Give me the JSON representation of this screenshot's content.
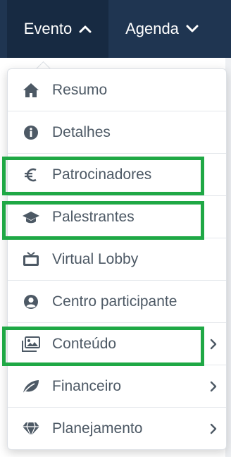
{
  "nav": {
    "evento": "Evento",
    "agenda": "Agenda"
  },
  "menu": {
    "items": [
      {
        "label": "Resumo",
        "icon": "home-icon",
        "has_submenu": false
      },
      {
        "label": "Detalhes",
        "icon": "info-circle-icon",
        "has_submenu": false
      },
      {
        "label": "Patrocinadores",
        "icon": "euro-icon",
        "has_submenu": false
      },
      {
        "label": "Palestrantes",
        "icon": "graduation-cap-icon",
        "has_submenu": false
      },
      {
        "label": "Virtual Lobby",
        "icon": "tv-icon",
        "has_submenu": false
      },
      {
        "label": "Centro participante",
        "icon": "user-circle-icon",
        "has_submenu": false
      },
      {
        "label": "Conteúdo",
        "icon": "images-icon",
        "has_submenu": true
      },
      {
        "label": "Financeiro",
        "icon": "leaf-icon",
        "has_submenu": true
      },
      {
        "label": "Planejamento",
        "icon": "gem-icon",
        "has_submenu": true
      }
    ]
  },
  "highlighted_items": [
    "Patrocinadores",
    "Palestrantes",
    "Conteúdo"
  ],
  "colors": {
    "topbar": "#1f3551",
    "topbar_active": "#172a42",
    "menu_text": "#4d5965",
    "highlight": "#1fa845"
  }
}
